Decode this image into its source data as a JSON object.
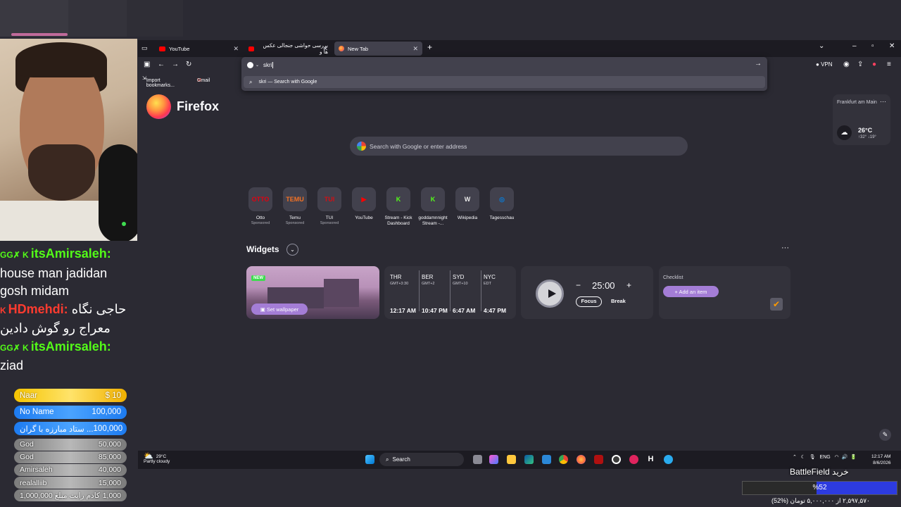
{
  "chat": {
    "lines": [
      {
        "badge": "GG",
        "user": "itsAmirsaleh:",
        "text": ""
      },
      {
        "text": "house man jadidan"
      },
      {
        "text": "gosh midam"
      },
      {
        "user": "HDmehdi:",
        "text": "حاجی نگاه"
      },
      {
        "text": "معراج رو گوش دادین"
      },
      {
        "badge": "GG",
        "user": "itsAmirsaleh:",
        "text": ""
      },
      {
        "text": "ziad"
      }
    ]
  },
  "donations": [
    {
      "name": "Naar",
      "amount": "$ 10",
      "style": "gold"
    },
    {
      "name": "No Name",
      "amount": "100,000",
      "style": "blue"
    },
    {
      "name": "ستاد مبارزه با گران ...",
      "amount": "100,000",
      "style": "blue"
    },
    {
      "name": "God",
      "amount": "50,000",
      "style": "gray"
    },
    {
      "name": "God",
      "amount": "85,000",
      "style": "gray"
    },
    {
      "name": "Amirsaleh",
      "amount": "40,000",
      "style": "gray"
    },
    {
      "name": "realalliib",
      "amount": "15,000",
      "style": "gray"
    },
    {
      "name": "کادم رایت مبلغ 1,000,000",
      "amount": "1,000",
      "style": "gray"
    }
  ],
  "browser": {
    "tabs": [
      {
        "label": "YouTube",
        "icon": "youtube-icon"
      },
      {
        "label": "بررسی حواشی جنجالی عکس ها و",
        "icon": "youtube-icon"
      },
      {
        "label": "New Tab",
        "icon": "firefox-icon",
        "active": true
      }
    ],
    "url_text": "skri",
    "suggestion": "skri — Search with Google",
    "vpn_label": "VPN",
    "bookmarks": [
      "Import bookmarks...",
      "Gmail"
    ],
    "brand": "Firefox",
    "search_placeholder": "Search with Google or enter address",
    "weather": {
      "city": "Frankfurt am Main",
      "temp": "26°C",
      "range": "↑32° ↓19°"
    },
    "shortcuts": [
      {
        "label": "Otto",
        "sub": "Sponsored",
        "tile": "OTTO",
        "color": "#e3000f"
      },
      {
        "label": "Temu",
        "sub": "Sponsored",
        "tile": "TEMU",
        "color": "#f57224"
      },
      {
        "label": "TUI",
        "sub": "Sponsored",
        "tile": "TUI",
        "color": "#d40e14"
      },
      {
        "label": "YouTube",
        "sub": "",
        "tile": "▶",
        "color": "#ff0000"
      },
      {
        "label": "Stream - Kick Dashboard",
        "sub": "",
        "tile": "K",
        "color": "#53fc18"
      },
      {
        "label": "goddamnnight Stream -...",
        "sub": "",
        "tile": "K",
        "color": "#53fc18"
      },
      {
        "label": "Wikipedia",
        "sub": "",
        "tile": "W",
        "color": "#e8e8e8"
      },
      {
        "label": "Tagesschau",
        "sub": "",
        "tile": "◎",
        "color": "#0a7bd6"
      }
    ],
    "widgets_title": "Widgets",
    "wallpaper": {
      "badge": "NEW",
      "button": "Set wallpaper"
    },
    "clocks": [
      {
        "city": "THR",
        "tz": "GMT+3:30",
        "time": "12:17 AM"
      },
      {
        "city": "BER",
        "tz": "GMT+2",
        "time": "10:47 PM"
      },
      {
        "city": "SYD",
        "tz": "GMT+10",
        "time": "6:47 AM"
      },
      {
        "city": "NYC",
        "tz": "EDT",
        "time": "4:47 PM"
      }
    ],
    "timer": {
      "minus": "−",
      "time": "25:00",
      "plus": "+",
      "focus": "Focus",
      "break": "Break"
    },
    "checklist": {
      "title": "Checklist",
      "add": "+  Add an item"
    }
  },
  "taskbar": {
    "weather_temp": "29°C",
    "weather_desc": "Partly cloudy",
    "search": "Search",
    "lang": "ENG",
    "time": "12:17 AM",
    "date": "8/6/2026"
  },
  "goal": {
    "title": "خرید BattleField",
    "percent": "%52",
    "percent_value": 52,
    "subtitle": "۲,۵۹۷,۵۷۰ از ۵,۰۰۰,۰۰۰ تومان (%52)"
  }
}
